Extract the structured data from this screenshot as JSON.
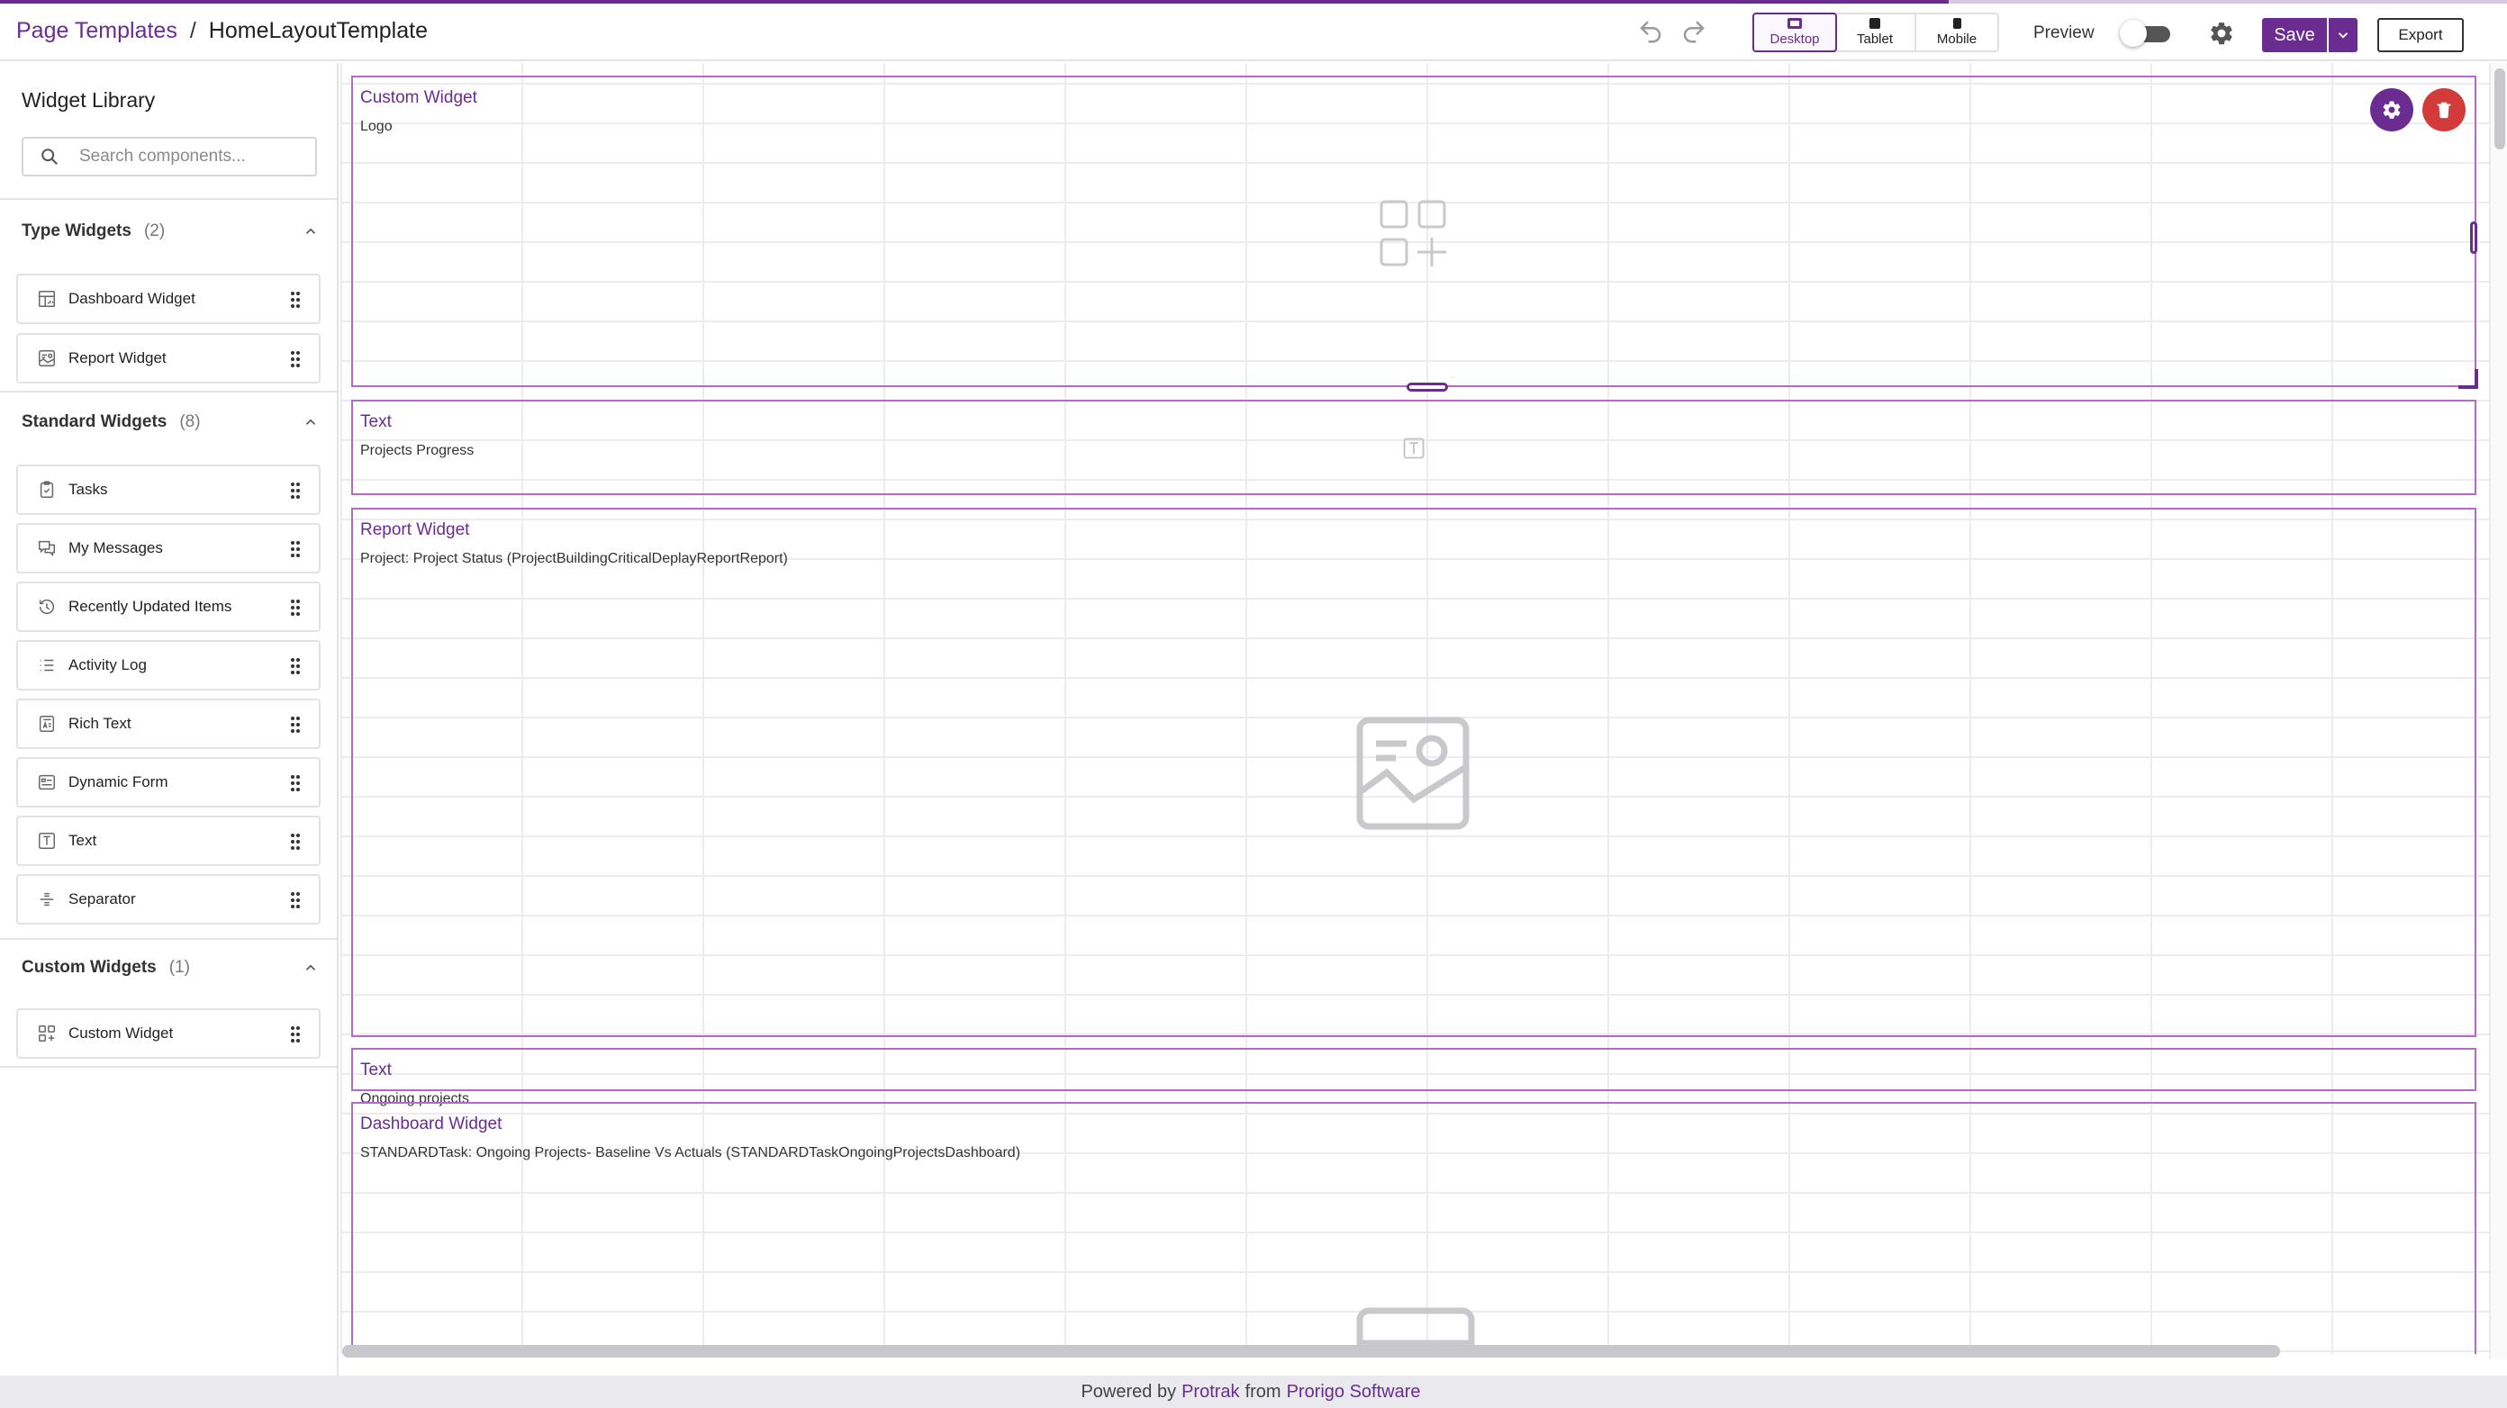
{
  "header": {
    "breadcrumb_root": "Page Templates",
    "breadcrumb_separator": "/",
    "breadcrumb_current": "HomeLayoutTemplate",
    "devices": [
      {
        "label": "Desktop",
        "active": true
      },
      {
        "label": "Tablet",
        "active": false
      },
      {
        "label": "Mobile",
        "active": false
      }
    ],
    "preview_label": "Preview",
    "preview_enabled": false,
    "save_label": "Save",
    "export_label": "Export"
  },
  "sidebar": {
    "title": "Widget Library",
    "search_placeholder": "Search components...",
    "sections": [
      {
        "title": "Type Widgets",
        "count": "(2)",
        "items": [
          {
            "label": "Dashboard Widget",
            "icon": "dashboard-icon"
          },
          {
            "label": "Report Widget",
            "icon": "report-icon"
          }
        ]
      },
      {
        "title": "Standard Widgets",
        "count": "(8)",
        "items": [
          {
            "label": "Tasks",
            "icon": "clipboard-check-icon"
          },
          {
            "label": "My Messages",
            "icon": "messages-icon"
          },
          {
            "label": "Recently Updated Items",
            "icon": "history-icon"
          },
          {
            "label": "Activity Log",
            "icon": "list-icon"
          },
          {
            "label": "Rich Text",
            "icon": "rich-text-icon"
          },
          {
            "label": "Dynamic Form",
            "icon": "form-icon"
          },
          {
            "label": "Text",
            "icon": "text-icon"
          },
          {
            "label": "Separator",
            "icon": "separator-icon"
          }
        ]
      },
      {
        "title": "Custom Widgets",
        "count": "(1)",
        "items": [
          {
            "label": "Custom Widget",
            "icon": "custom-widget-icon"
          }
        ]
      }
    ]
  },
  "canvas": {
    "widgets": [
      {
        "title": "Custom Widget",
        "subtitle": "Logo",
        "selected": true
      },
      {
        "title": "Text",
        "subtitle": "Projects Progress"
      },
      {
        "title": "Report Widget",
        "subtitle": "Project: Project Status (ProjectBuildingCriticalDeplayReportReport)"
      },
      {
        "title": "Text",
        "subtitle": "Ongoing projects"
      },
      {
        "title": "Dashboard Widget",
        "subtitle": "STANDARDTask: Ongoing Projects- Baseline Vs Actuals (STANDARDTaskOngoingProjectsDashboard)"
      }
    ]
  },
  "footer": {
    "prefix": "Powered by",
    "product": "Protrak",
    "middle": "from",
    "company": "Prorigo Software"
  },
  "colors": {
    "brand": "#6b2c91",
    "danger": "#d33b3b",
    "widget_border": "#b56ac6"
  }
}
